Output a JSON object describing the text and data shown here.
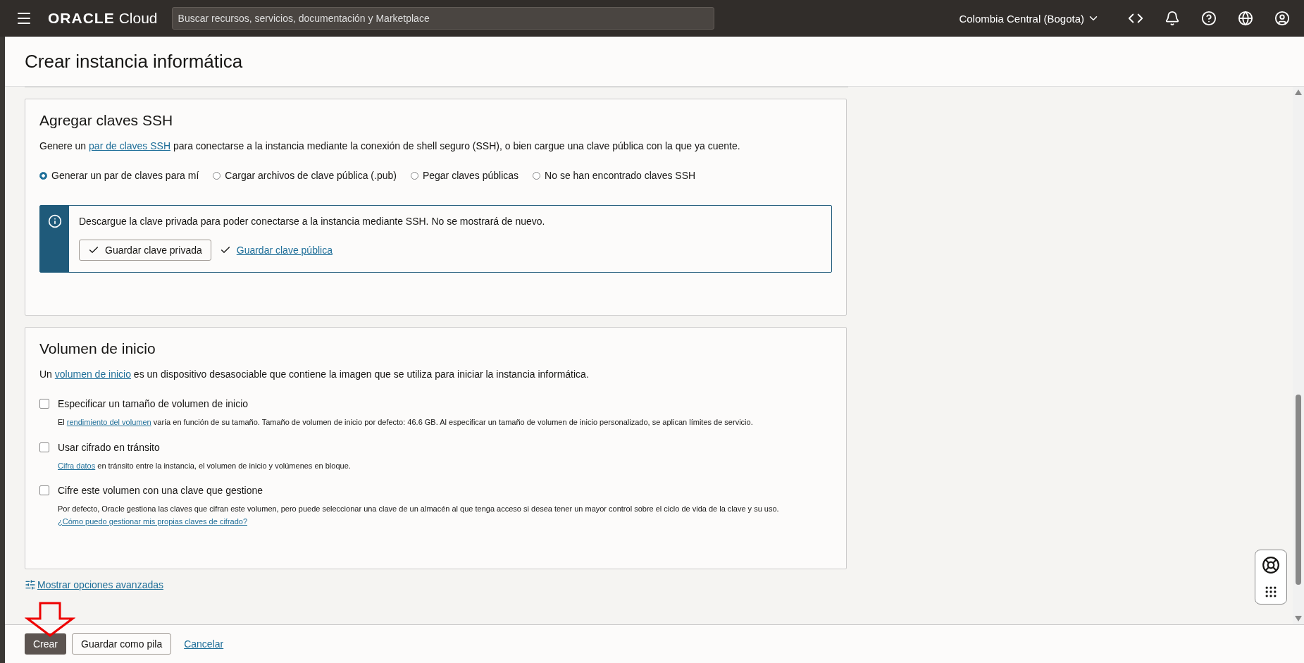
{
  "topbar": {
    "brand": "ORACLE",
    "product": "Cloud",
    "search": {
      "placeholder": "Buscar recursos, servicios, documentación y Marketplace"
    },
    "region": "Colombia Central (Bogota)"
  },
  "page_title": "Crear instancia informática",
  "ssh": {
    "heading": "Agregar claves SSH",
    "intro": {
      "before": "Genere un ",
      "link": "par de claves SSH",
      "after": " para conectarse a la instancia mediante la conexión de shell seguro (SSH), o bien cargue una clave pública con la que ya cuente."
    },
    "options": [
      {
        "label": "Generar un par de claves para mí",
        "selected": true
      },
      {
        "label": "Cargar archivos de clave pública (.pub)",
        "selected": false
      },
      {
        "label": "Pegar claves públicas",
        "selected": false
      },
      {
        "label": "No se han encontrado claves SSH",
        "selected": false
      }
    ],
    "notice": {
      "text": "Descargue la clave privada para poder conectarse a la instancia mediante SSH. No se mostrará de nuevo.",
      "save_private": "Guardar clave privada",
      "save_public": "Guardar clave pública"
    }
  },
  "boot_volume": {
    "heading": "Volumen de inicio",
    "intro": {
      "before": "Un ",
      "link": "volumen de inicio",
      "after": " es un dispositivo desasociable que contiene la imagen que se utiliza para iniciar la instancia informática."
    },
    "checks": [
      {
        "label": "Especificar un tamaño de volumen de inicio",
        "checked": false,
        "hint": {
          "before": "El ",
          "link": "rendimiento del volumen",
          "after": " varía en función de su tamaño. Tamaño de volumen de inicio por defecto: 46.6 GB. Al especificar un tamaño de volumen de inicio personalizado, se aplican límites de servicio."
        }
      },
      {
        "label": "Usar cifrado en tránsito",
        "checked": false,
        "hint": {
          "link": "Cifra datos",
          "after": " en tránsito entre la instancia, el volumen de inicio y volúmenes en bloque."
        }
      },
      {
        "label": "Cifre este volumen con una clave que gestione",
        "checked": false,
        "hint": {
          "before": "Por defecto, Oracle gestiona las claves que cifran este volumen, pero puede seleccionar una clave de un almacén al que tenga acceso si desea tener un mayor control sobre el ciclo de vida de la clave y su uso. ",
          "link": "¿Cómo puedo gestionar mis propias claves de cifrado?"
        }
      }
    ]
  },
  "advanced_link": "Mostrar opciones avanzadas",
  "footer": {
    "create": "Crear",
    "save_stack": "Guardar como pila",
    "cancel": "Cancelar"
  }
}
